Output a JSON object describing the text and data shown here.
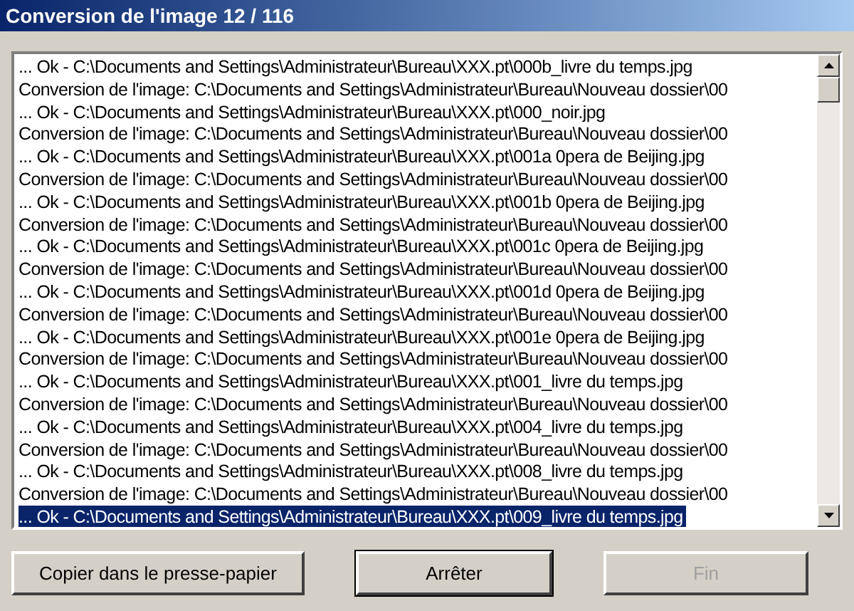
{
  "window": {
    "title": "Conversion de l'image 12 / 116"
  },
  "log": {
    "rows": [
      {
        "text": "... Ok - C:\\Documents and Settings\\Administrateur\\Bureau\\XXX.pt\\000b_livre du temps.jpg",
        "selected": false
      },
      {
        "text": "Conversion de l'image: C:\\Documents and Settings\\Administrateur\\Bureau\\Nouveau dossier\\00",
        "selected": false
      },
      {
        "text": "... Ok - C:\\Documents and Settings\\Administrateur\\Bureau\\XXX.pt\\000_noir.jpg",
        "selected": false
      },
      {
        "text": "Conversion de l'image: C:\\Documents and Settings\\Administrateur\\Bureau\\Nouveau dossier\\00",
        "selected": false
      },
      {
        "text": "... Ok - C:\\Documents and Settings\\Administrateur\\Bureau\\XXX.pt\\001a 0pera de Beijing.jpg",
        "selected": false
      },
      {
        "text": "Conversion de l'image: C:\\Documents and Settings\\Administrateur\\Bureau\\Nouveau dossier\\00",
        "selected": false
      },
      {
        "text": "... Ok - C:\\Documents and Settings\\Administrateur\\Bureau\\XXX.pt\\001b 0pera de Beijing.jpg",
        "selected": false
      },
      {
        "text": "Conversion de l'image: C:\\Documents and Settings\\Administrateur\\Bureau\\Nouveau dossier\\00",
        "selected": false
      },
      {
        "text": "... Ok - C:\\Documents and Settings\\Administrateur\\Bureau\\XXX.pt\\001c 0pera de Beijing.jpg",
        "selected": false
      },
      {
        "text": "Conversion de l'image: C:\\Documents and Settings\\Administrateur\\Bureau\\Nouveau dossier\\00",
        "selected": false
      },
      {
        "text": "... Ok - C:\\Documents and Settings\\Administrateur\\Bureau\\XXX.pt\\001d 0pera de Beijing.jpg",
        "selected": false
      },
      {
        "text": "Conversion de l'image: C:\\Documents and Settings\\Administrateur\\Bureau\\Nouveau dossier\\00",
        "selected": false
      },
      {
        "text": "... Ok - C:\\Documents and Settings\\Administrateur\\Bureau\\XXX.pt\\001e 0pera de Beijing.jpg",
        "selected": false
      },
      {
        "text": "Conversion de l'image: C:\\Documents and Settings\\Administrateur\\Bureau\\Nouveau dossier\\00",
        "selected": false
      },
      {
        "text": "... Ok - C:\\Documents and Settings\\Administrateur\\Bureau\\XXX.pt\\001_livre du temps.jpg",
        "selected": false
      },
      {
        "text": "Conversion de l'image: C:\\Documents and Settings\\Administrateur\\Bureau\\Nouveau dossier\\00",
        "selected": false
      },
      {
        "text": "... Ok - C:\\Documents and Settings\\Administrateur\\Bureau\\XXX.pt\\004_livre du temps.jpg",
        "selected": false
      },
      {
        "text": "Conversion de l'image: C:\\Documents and Settings\\Administrateur\\Bureau\\Nouveau dossier\\00",
        "selected": false
      },
      {
        "text": "... Ok - C:\\Documents and Settings\\Administrateur\\Bureau\\XXX.pt\\008_livre du temps.jpg",
        "selected": false
      },
      {
        "text": "Conversion de l'image: C:\\Documents and Settings\\Administrateur\\Bureau\\Nouveau dossier\\00",
        "selected": false
      },
      {
        "text": "... Ok - C:\\Documents and Settings\\Administrateur\\Bureau\\XXX.pt\\009_livre du temps.jpg",
        "selected": true
      }
    ]
  },
  "buttons": [
    {
      "label": "Copier dans le presse-papier",
      "default": false,
      "disabled": false
    },
    {
      "label": "Arrêter",
      "default": true,
      "disabled": false
    },
    {
      "label": "Fin",
      "default": false,
      "disabled": true
    }
  ]
}
